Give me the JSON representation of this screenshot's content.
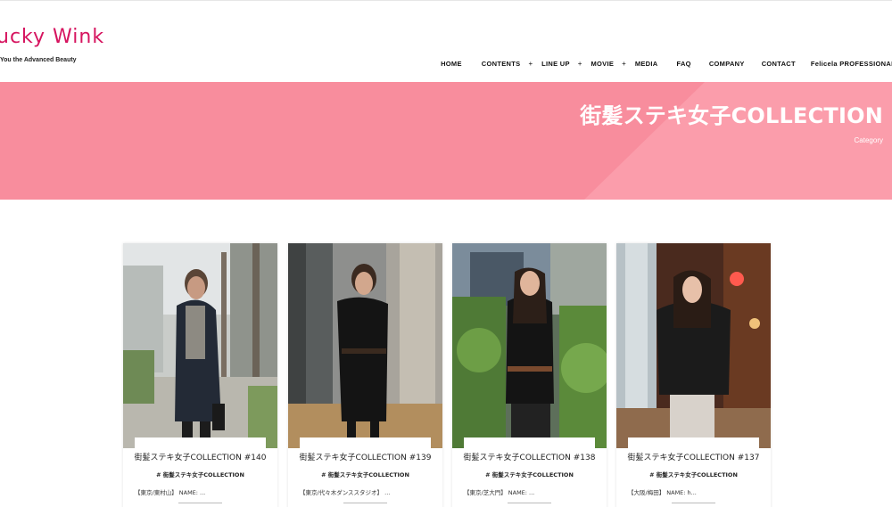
{
  "header": {
    "logo_text": "ucky Wink",
    "tagline": "You the Advanced Beauty",
    "brand_color": "#d6145f"
  },
  "nav": {
    "items": [
      {
        "label": "HOME",
        "has_submenu": false
      },
      {
        "label": "CONTENTS",
        "has_submenu": true
      },
      {
        "label": "LINE UP",
        "has_submenu": true
      },
      {
        "label": "MOVIE",
        "has_submenu": true
      },
      {
        "label": "MEDIA",
        "has_submenu": false
      },
      {
        "label": "FAQ",
        "has_submenu": false
      },
      {
        "label": "COMPANY",
        "has_submenu": false
      },
      {
        "label": "CONTACT",
        "has_submenu": false
      },
      {
        "label": "Felicela PROFESSIONAL",
        "has_submenu": false
      }
    ],
    "submenu_marker": "+"
  },
  "hero": {
    "title": "街髪ステキ女子COLLECTION",
    "breadcrumb": "Category",
    "background_color": "#f88d9d"
  },
  "posts": [
    {
      "title": "街髪ステキ女子COLLECTION #140",
      "category": "# 街髪ステキ女子COLLECTION",
      "excerpt": "【東京/東村山】 NAME: ..."
    },
    {
      "title": "街髪ステキ女子COLLECTION #139",
      "category": "# 街髪ステキ女子COLLECTION",
      "excerpt": "【東京/代々木ダンススタジオ】 ..."
    },
    {
      "title": "街髪ステキ女子COLLECTION #138",
      "category": "# 街髪ステキ女子COLLECTION",
      "excerpt": "【東京/芝大門】 NAME: ..."
    },
    {
      "title": "街髪ステキ女子COLLECTION #137",
      "category": "# 街髪ステキ女子COLLECTION",
      "excerpt": "【大阪/梅田】 NAME: h..."
    }
  ]
}
